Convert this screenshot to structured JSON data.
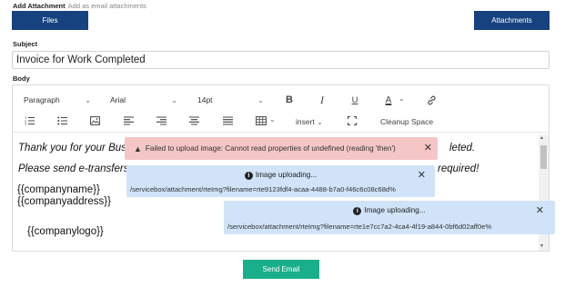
{
  "attachment": {
    "label": "Add Attachment",
    "hint": "Add as email attachments",
    "files_button": "Files",
    "attachments_button": "Attachments"
  },
  "subject": {
    "label": "Subject",
    "value": "Invoice for Work Completed"
  },
  "body": {
    "label": "Body"
  },
  "toolbar": {
    "block_format": "Paragraph",
    "font_family": "Arial",
    "font_size": "14pt",
    "bold_icon": "B",
    "italic_icon": "I",
    "underline_icon": "U",
    "text_color_icon": "A",
    "insert_label": "insert",
    "cleanup_label": "Cleanup Space"
  },
  "content": {
    "line1_start": "Thank you for your Bus",
    "line1_end": "leted.",
    "line2_start": "Please send e-transfers",
    "line2_end": "required!",
    "company_name": "{{companyname}}",
    "company_address": "{{companyaddress}}",
    "company_logo": "{{companylogo}}"
  },
  "notifications": {
    "error_text": "Failed to upload image: Cannot read properties of undefined (reading 'then')",
    "upload1_title": "Image uploading...",
    "upload1_path": "/servicebox/attachment/rteImg?filename=rte9123fdf4-acaa-4488-b7a0-f46c6c08c68d%",
    "upload2_title": "Image uploading...",
    "upload2_path": "/servicebox/attachment/rteImg?filename=rte1e7cc7a2-4ca4-4f19-a844-0bf6d02aff0e%",
    "close_glyph": "✕"
  },
  "send_button": "Send Email",
  "colors": {
    "navy_button": "#16427f",
    "send_button": "#1aaf8b",
    "error_toast": "#f4c6c6",
    "info_toast": "#d0e3f8"
  }
}
